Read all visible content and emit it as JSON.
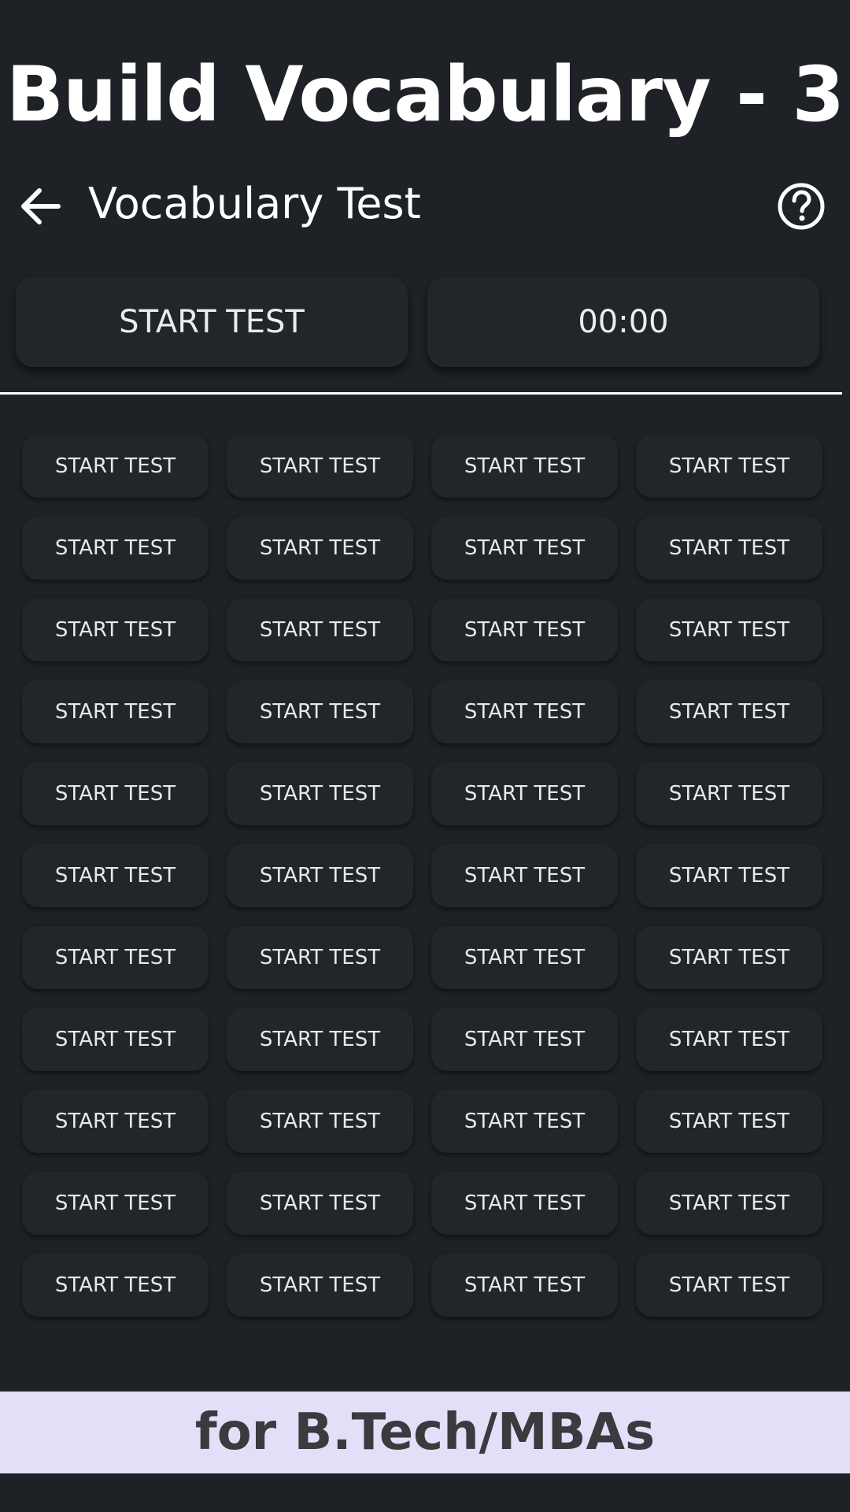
{
  "banner": {
    "title": "Build Vocabulary - 3"
  },
  "toolbar": {
    "back_icon": "arrow-left-icon",
    "title": "Vocabulary Test",
    "help_icon": "help-circle-icon"
  },
  "controls": {
    "start_label": "START TEST",
    "timer": "00:00"
  },
  "grid": {
    "rows": 11,
    "columns": 4,
    "button_label": "START TEST"
  },
  "footer": {
    "text": "for B.Tech/MBAs"
  },
  "colors": {
    "background": "#1e2125",
    "button": "#22262b",
    "footer_background": "#e3dff8",
    "footer_text": "#3a3a3f"
  }
}
